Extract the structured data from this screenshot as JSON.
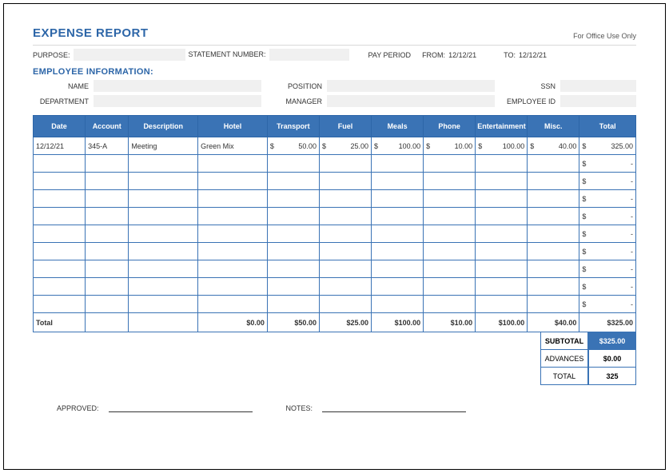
{
  "header": {
    "title": "EXPENSE REPORT",
    "office_only": "For Office Use Only"
  },
  "meta": {
    "purpose_label": "PURPOSE:",
    "statement_label": "STATEMENT NUMBER:",
    "pay_period_label": "PAY PERIOD",
    "from_label": "FROM:",
    "from_value": "12/12/21",
    "to_label": "TO:",
    "to_value": "12/12/21"
  },
  "employee": {
    "section_title": "EMPLOYEE INFORMATION:",
    "name_label": "NAME",
    "position_label": "POSITION",
    "ssn_label": "SSN",
    "department_label": "DEPARTMENT",
    "manager_label": "MANAGER",
    "employee_id_label": "EMPLOYEE ID"
  },
  "columns": {
    "date": "Date",
    "account": "Account",
    "description": "Description",
    "hotel": "Hotel",
    "transport": "Transport",
    "fuel": "Fuel",
    "meals": "Meals",
    "phone": "Phone",
    "entertainment": "Entertainment",
    "misc": "Misc.",
    "total": "Total"
  },
  "rows": [
    {
      "date": "12/12/21",
      "account": "345-A",
      "description": "Meeting",
      "hotel": "Green Mix",
      "transport": "50.00",
      "fuel": "25.00",
      "meals": "100.00",
      "phone": "10.00",
      "entertainment": "100.00",
      "misc": "40.00",
      "total": "325.00"
    }
  ],
  "totals_row": {
    "label": "Total",
    "hotel": "$0.00",
    "transport": "$50.00",
    "fuel": "$25.00",
    "meals": "$100.00",
    "phone": "$10.00",
    "entertainment": "$100.00",
    "misc": "$40.00",
    "total": "$325.00"
  },
  "summary": {
    "subtotal_label": "SUBTOTAL",
    "subtotal_value": "$325.00",
    "advances_label": "ADVANCES",
    "advances_value": "$0.00",
    "total_label": "TOTAL",
    "total_value": "325"
  },
  "footer": {
    "approved_label": "APPROVED:",
    "notes_label": "NOTES:"
  },
  "sym": {
    "dollar": "$",
    "dash": "-"
  }
}
